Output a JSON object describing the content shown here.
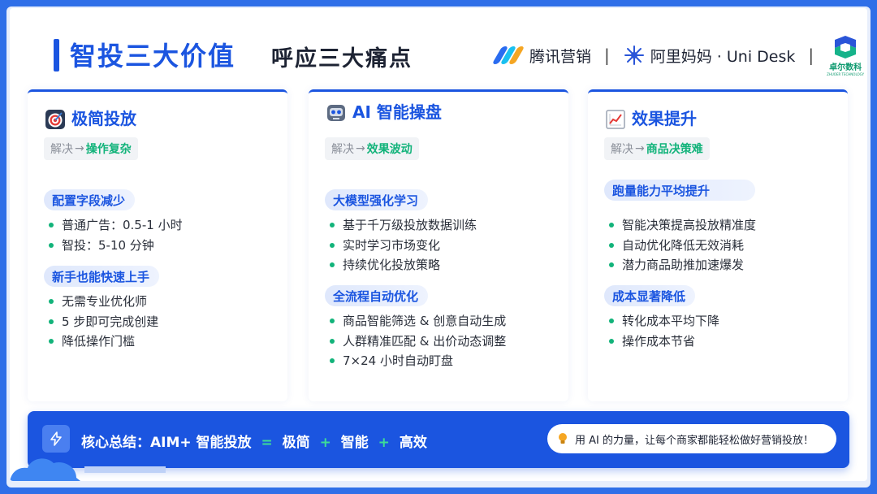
{
  "header": {
    "title": "智投三大价值",
    "subtitle": "呼应三大痛点",
    "brands": {
      "tencent": "腾讯营销",
      "alimama": "阿里妈妈 · Uni Desk",
      "zhuoer": "卓尔数科",
      "zhuoer_sub": "ZHUOER TECHNOLOGY"
    }
  },
  "cards": [
    {
      "title": "极简投放",
      "icon": "target-icon",
      "solve_prefix": "解决",
      "solve_key": "操作复杂",
      "sections": [
        {
          "heading": "配置字段减少",
          "items": [
            "普通广告：0.5-1 小时",
            "智投：5-10 分钟"
          ]
        },
        {
          "heading": "新手也能快速上手",
          "items": [
            "无需专业优化师",
            "5 步即可完成创建",
            "降低操作门槛"
          ]
        }
      ]
    },
    {
      "title": "AI 智能操盘",
      "icon": "robot-icon",
      "solve_prefix": "解决",
      "solve_key": "效果波动",
      "sections": [
        {
          "heading": "大模型强化学习",
          "items": [
            "基于千万级投放数据训练",
            "实时学习市场变化",
            "持续优化投放策略"
          ]
        },
        {
          "heading": "全流程自动优化",
          "items": [
            "商品智能筛选 & 创意自动生成",
            "人群精准匹配 & 出价动态调整",
            "7×24 小时自动盯盘"
          ]
        }
      ]
    },
    {
      "title": "效果提升",
      "icon": "chart-up-icon",
      "solve_prefix": "解决",
      "solve_key": "商品决策难",
      "sections": [
        {
          "heading": "跑量能力平均提升",
          "items": [
            "智能决策提高投放精准度",
            "自动优化降低无效消耗",
            "潜力商品助推加速爆发"
          ]
        },
        {
          "heading": "成本显著降低",
          "items": [
            "转化成本平均下降",
            "操作成本节省"
          ]
        }
      ]
    }
  ],
  "bottom": {
    "summary_label": "核心总结：AIM+ 智能投放",
    "eq": "=",
    "terms": [
      "极简",
      "智能",
      "高效"
    ],
    "plus": "+",
    "quote": "用 AI 的力量，让每个商家都能轻松做好营销投放！"
  },
  "colors": {
    "brand_blue": "#1b55e0",
    "accent_green": "#12b37a"
  }
}
